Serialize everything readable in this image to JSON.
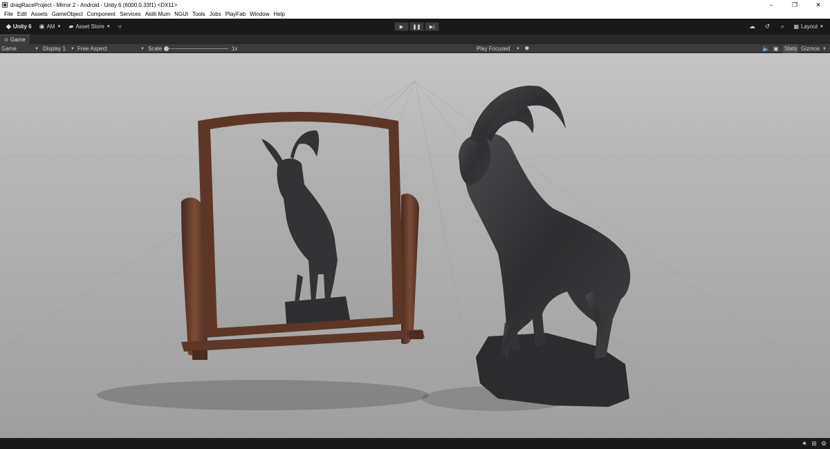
{
  "window": {
    "title": "dragRaceProject - Mirror 2 - Android - Unity 6 (6000.0.33f1) <DX11>",
    "controls": {
      "minimize": "–",
      "restore": "❐",
      "close": "✕"
    }
  },
  "menu": [
    "File",
    "Edit",
    "Assets",
    "GameObject",
    "Component",
    "Services",
    "Akilli Mum",
    "NGUI",
    "Tools",
    "Jobs",
    "PlayFab",
    "Window",
    "Help"
  ],
  "toolbar": {
    "unity_label": "Unity 6",
    "account_label": "AM",
    "asset_store_label": "Asset Store",
    "play_icon": "▶",
    "pause_icon": "❚❚",
    "step_icon": "▶|",
    "layout_label": "Layout"
  },
  "game_view": {
    "tab_label": "Game",
    "mode": "Game",
    "display": "Display 1",
    "aspect": "Free Aspect",
    "scale_label": "Scale",
    "scale_value": "1x",
    "scale_level": 0,
    "play_mode": "Play Focused",
    "stats_label": "Stats",
    "gizmos_label": "Gizmos"
  },
  "colors": {
    "editor_bg": "#191919",
    "panel_bg": "#3c3c3c",
    "floor": "#a9a9a9",
    "mirror_frame": "#6b3e2a",
    "statue": "#3a3a3c"
  },
  "icons": {
    "unity": "unity-logo-icon",
    "account": "account-icon",
    "asset_store": "asset-store-icon",
    "cloud": "cloud-icon",
    "history": "history-icon",
    "search": "search-icon",
    "layout": "layout-icon",
    "mute": "speaker-icon",
    "bug": "bug-icon"
  }
}
